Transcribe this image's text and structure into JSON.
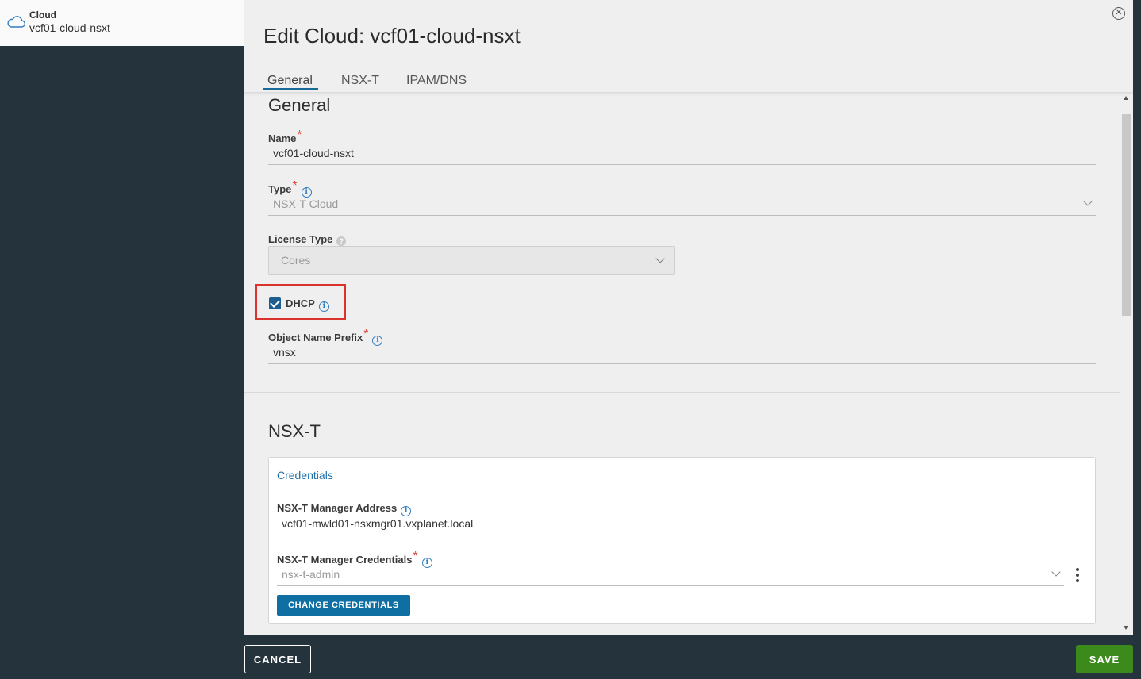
{
  "sidebar": {
    "cloud_label": "Cloud",
    "cloud_name": "vcf01-cloud-nsxt"
  },
  "modal": {
    "title": "Edit Cloud: vcf01-cloud-nsxt",
    "tabs": [
      {
        "label": "General",
        "active": true
      },
      {
        "label": "NSX-T",
        "active": false
      },
      {
        "label": "IPAM/DNS",
        "active": false
      }
    ]
  },
  "general": {
    "section_title": "General",
    "name": {
      "label": "Name",
      "value": "vcf01-cloud-nsxt"
    },
    "type": {
      "label": "Type",
      "value": "NSX-T Cloud"
    },
    "license_type": {
      "label": "License Type",
      "value": "Cores"
    },
    "dhcp": {
      "label": "DHCP",
      "checked": true
    },
    "object_name_prefix": {
      "label": "Object Name Prefix",
      "value": "vnsx"
    }
  },
  "nsxt": {
    "section_title": "NSX-T",
    "credentials_title": "Credentials",
    "manager_address": {
      "label": "NSX-T Manager Address",
      "value": "vcf01-mwld01-nsxmgr01.vxplanet.local"
    },
    "manager_credentials": {
      "label": "NSX-T Manager Credentials",
      "value": "nsx-t-admin"
    },
    "change_credentials_label": "CHANGE CREDENTIALS"
  },
  "footer": {
    "cancel_label": "CANCEL",
    "save_label": "SAVE"
  },
  "colors": {
    "sidebar_bg": "#25333d",
    "modal_bg": "#efefef",
    "primary": "#0f6fa3",
    "save_green": "#3d8a1c",
    "required_red": "#e0463b",
    "highlight_red": "#d9332b"
  }
}
